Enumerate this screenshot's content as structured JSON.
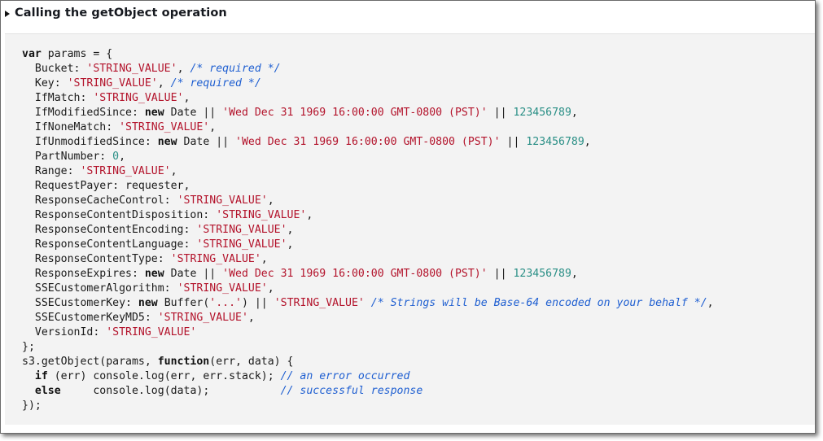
{
  "summary": {
    "title": "Calling the getObject operation"
  },
  "code_lines": [
    [
      {
        "k": "kw",
        "t": "var"
      },
      {
        "k": "",
        "t": " params = {"
      }
    ],
    [
      {
        "k": "",
        "t": "  Bucket: "
      },
      {
        "k": "str",
        "t": "'STRING_VALUE'"
      },
      {
        "k": "",
        "t": ", "
      },
      {
        "k": "cm",
        "t": "/* required */"
      }
    ],
    [
      {
        "k": "",
        "t": "  Key: "
      },
      {
        "k": "str",
        "t": "'STRING_VALUE'"
      },
      {
        "k": "",
        "t": ", "
      },
      {
        "k": "cm",
        "t": "/* required */"
      }
    ],
    [
      {
        "k": "",
        "t": "  IfMatch: "
      },
      {
        "k": "str",
        "t": "'STRING_VALUE'"
      },
      {
        "k": "",
        "t": ","
      }
    ],
    [
      {
        "k": "",
        "t": "  IfModifiedSince: "
      },
      {
        "k": "kw",
        "t": "new"
      },
      {
        "k": "",
        "t": " Date || "
      },
      {
        "k": "str",
        "t": "'Wed Dec 31 1969 16:00:00 GMT-0800 (PST)'"
      },
      {
        "k": "",
        "t": " || "
      },
      {
        "k": "num",
        "t": "123456789"
      },
      {
        "k": "",
        "t": ","
      }
    ],
    [
      {
        "k": "",
        "t": "  IfNoneMatch: "
      },
      {
        "k": "str",
        "t": "'STRING_VALUE'"
      },
      {
        "k": "",
        "t": ","
      }
    ],
    [
      {
        "k": "",
        "t": "  IfUnmodifiedSince: "
      },
      {
        "k": "kw",
        "t": "new"
      },
      {
        "k": "",
        "t": " Date || "
      },
      {
        "k": "str",
        "t": "'Wed Dec 31 1969 16:00:00 GMT-0800 (PST)'"
      },
      {
        "k": "",
        "t": " || "
      },
      {
        "k": "num",
        "t": "123456789"
      },
      {
        "k": "",
        "t": ","
      }
    ],
    [
      {
        "k": "",
        "t": "  PartNumber: "
      },
      {
        "k": "num",
        "t": "0"
      },
      {
        "k": "",
        "t": ","
      }
    ],
    [
      {
        "k": "",
        "t": "  Range: "
      },
      {
        "k": "str",
        "t": "'STRING_VALUE'"
      },
      {
        "k": "",
        "t": ","
      }
    ],
    [
      {
        "k": "",
        "t": "  RequestPayer: requester,"
      }
    ],
    [
      {
        "k": "",
        "t": "  ResponseCacheControl: "
      },
      {
        "k": "str",
        "t": "'STRING_VALUE'"
      },
      {
        "k": "",
        "t": ","
      }
    ],
    [
      {
        "k": "",
        "t": "  ResponseContentDisposition: "
      },
      {
        "k": "str",
        "t": "'STRING_VALUE'"
      },
      {
        "k": "",
        "t": ","
      }
    ],
    [
      {
        "k": "",
        "t": "  ResponseContentEncoding: "
      },
      {
        "k": "str",
        "t": "'STRING_VALUE'"
      },
      {
        "k": "",
        "t": ","
      }
    ],
    [
      {
        "k": "",
        "t": "  ResponseContentLanguage: "
      },
      {
        "k": "str",
        "t": "'STRING_VALUE'"
      },
      {
        "k": "",
        "t": ","
      }
    ],
    [
      {
        "k": "",
        "t": "  ResponseContentType: "
      },
      {
        "k": "str",
        "t": "'STRING_VALUE'"
      },
      {
        "k": "",
        "t": ","
      }
    ],
    [
      {
        "k": "",
        "t": "  ResponseExpires: "
      },
      {
        "k": "kw",
        "t": "new"
      },
      {
        "k": "",
        "t": " Date || "
      },
      {
        "k": "str",
        "t": "'Wed Dec 31 1969 16:00:00 GMT-0800 (PST)'"
      },
      {
        "k": "",
        "t": " || "
      },
      {
        "k": "num",
        "t": "123456789"
      },
      {
        "k": "",
        "t": ","
      }
    ],
    [
      {
        "k": "",
        "t": "  SSECustomerAlgorithm: "
      },
      {
        "k": "str",
        "t": "'STRING_VALUE'"
      },
      {
        "k": "",
        "t": ","
      }
    ],
    [
      {
        "k": "",
        "t": "  SSECustomerKey: "
      },
      {
        "k": "kw",
        "t": "new"
      },
      {
        "k": "",
        "t": " Buffer("
      },
      {
        "k": "str",
        "t": "'...'"
      },
      {
        "k": "",
        "t": ") || "
      },
      {
        "k": "str",
        "t": "'STRING_VALUE'"
      },
      {
        "k": "",
        "t": " "
      },
      {
        "k": "cm",
        "t": "/* Strings will be Base-64 encoded on your behalf */"
      },
      {
        "k": "",
        "t": ","
      }
    ],
    [
      {
        "k": "",
        "t": "  SSECustomerKeyMD5: "
      },
      {
        "k": "str",
        "t": "'STRING_VALUE'"
      },
      {
        "k": "",
        "t": ","
      }
    ],
    [
      {
        "k": "",
        "t": "  VersionId: "
      },
      {
        "k": "str",
        "t": "'STRING_VALUE'"
      }
    ],
    [
      {
        "k": "",
        "t": "};"
      }
    ],
    [
      {
        "k": "",
        "t": "s3.getObject(params, "
      },
      {
        "k": "kw",
        "t": "function"
      },
      {
        "k": "",
        "t": "(err, data) {"
      }
    ],
    [
      {
        "k": "",
        "t": "  "
      },
      {
        "k": "kw",
        "t": "if"
      },
      {
        "k": "",
        "t": " (err) console.log(err, err.stack); "
      },
      {
        "k": "cm",
        "t": "// an error occurred"
      }
    ],
    [
      {
        "k": "",
        "t": "  "
      },
      {
        "k": "kw",
        "t": "else"
      },
      {
        "k": "",
        "t": "     console.log(data);           "
      },
      {
        "k": "cm",
        "t": "// successful response"
      }
    ],
    [
      {
        "k": "",
        "t": "});"
      }
    ]
  ],
  "colors": {
    "keyword": "#111111",
    "string": "#b3132b",
    "number": "#2a8f86",
    "comment": "#1f5fd1",
    "code_background": "#f3f3f3"
  },
  "icons": {
    "disclosure": "caret-right-icon"
  }
}
